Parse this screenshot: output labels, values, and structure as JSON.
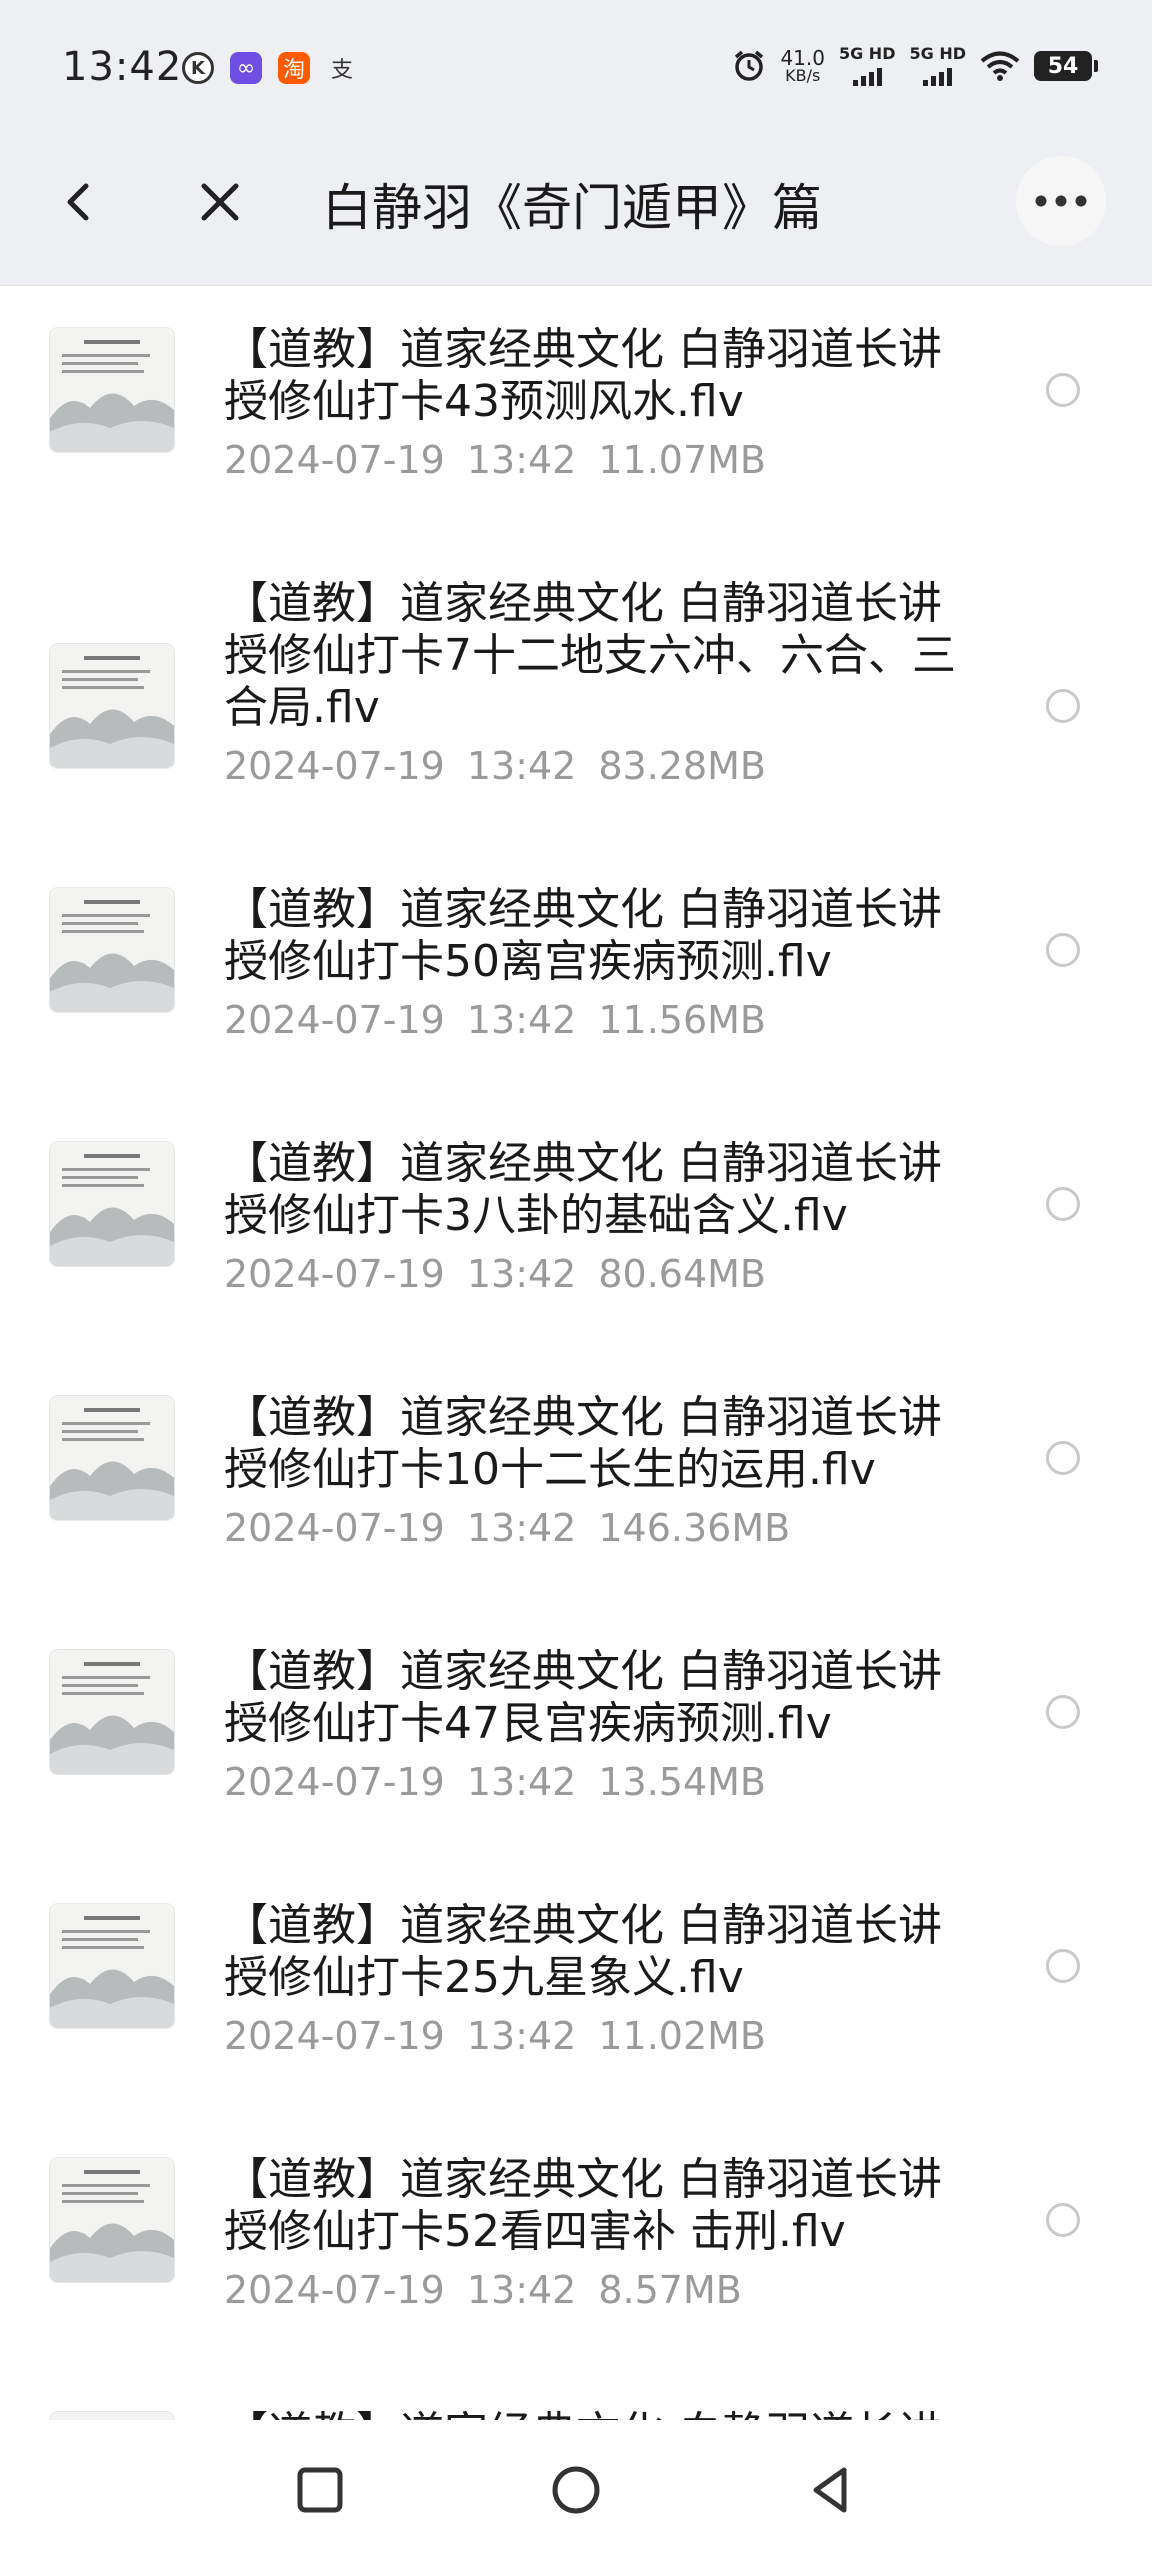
{
  "status_bar": {
    "time": "13:42",
    "app_icons": [
      {
        "name": "k-app-icon",
        "glyph": "K",
        "bg": "#ffffff",
        "fg": "#333333"
      },
      {
        "name": "infinity-app-icon",
        "glyph": "∞",
        "bg": "#6f4ee3",
        "fg": "#ffffff"
      },
      {
        "name": "taobao-app-icon",
        "glyph": "淘",
        "bg": "#ff5a00",
        "fg": "#ffffff"
      },
      {
        "name": "alipay-app-icon",
        "glyph": "支",
        "bg": "#eeeff2",
        "fg": "#333333"
      }
    ],
    "net_speed_value": "41.0",
    "net_speed_unit": "KB/s",
    "sim1": "5G HD",
    "sim2": "5G HD",
    "battery": "54"
  },
  "header": {
    "title": "白静羽《奇门遁甲》篇"
  },
  "files": [
    {
      "name": "【道教】道家经典文化 白静羽道长讲授修仙打卡43预测风水.flv",
      "date": "2024-07-19",
      "time": "13:42",
      "size": "11.07MB"
    },
    {
      "name": "【道教】道家经典文化 白静羽道长讲授修仙打卡7十二地支六冲、六合、三合局.flv",
      "date": "2024-07-19",
      "time": "13:42",
      "size": "83.28MB"
    },
    {
      "name": "【道教】道家经典文化 白静羽道长讲授修仙打卡50离宫疾病预测.flv",
      "date": "2024-07-19",
      "time": "13:42",
      "size": "11.56MB"
    },
    {
      "name": "【道教】道家经典文化 白静羽道长讲授修仙打卡3八卦的基础含义.flv",
      "date": "2024-07-19",
      "time": "13:42",
      "size": "80.64MB"
    },
    {
      "name": "【道教】道家经典文化 白静羽道长讲授修仙打卡10十二长生的运用.flv",
      "date": "2024-07-19",
      "time": "13:42",
      "size": "146.36MB"
    },
    {
      "name": "【道教】道家经典文化 白静羽道长讲授修仙打卡47艮宫疾病预测.flv",
      "date": "2024-07-19",
      "time": "13:42",
      "size": "13.54MB"
    },
    {
      "name": "【道教】道家经典文化 白静羽道长讲授修仙打卡25九星象义.flv",
      "date": "2024-07-19",
      "time": "13:42",
      "size": "11.02MB"
    },
    {
      "name": "【道教】道家经典文化 白静羽道长讲授修仙打卡52看四害补 击刑.flv",
      "date": "2024-07-19",
      "time": "13:42",
      "size": "8.57MB"
    },
    {
      "name": "【道教】道家经典文化 白静羽道长讲授",
      "date": "",
      "time": "",
      "size": ""
    }
  ]
}
